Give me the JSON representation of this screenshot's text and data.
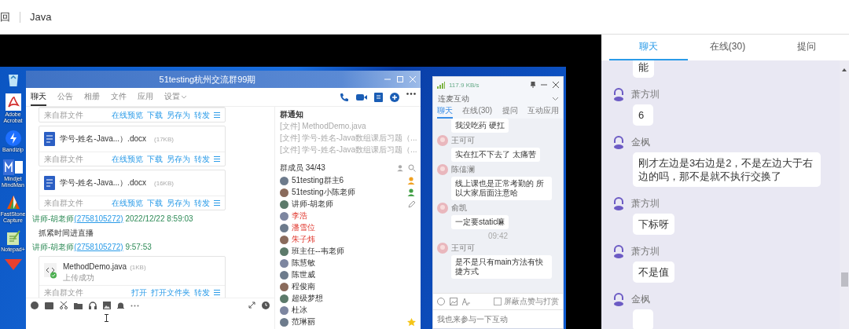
{
  "top_bar": {
    "back": "回",
    "title": "Java"
  },
  "desktop_icons": [
    {
      "kind": "recycle"
    },
    {
      "kind": "pdf",
      "label": "Adobe Acrobat"
    },
    {
      "kind": "zip",
      "label": "Bandizip"
    },
    {
      "kind": "mindmap",
      "label": "Mindjet MindMan"
    },
    {
      "kind": "capture",
      "label": "FastStone Capture"
    },
    {
      "kind": "notepad",
      "label": "Notepad+"
    },
    {
      "kind": "office"
    }
  ],
  "qq_window": {
    "title": "51testing杭州交流群99期",
    "tabs": [
      {
        "label": "聊天",
        "selected": true
      },
      {
        "label": "公告",
        "selected": false
      },
      {
        "label": "相册",
        "selected": false
      },
      {
        "label": "文件",
        "selected": false
      },
      {
        "label": "应用",
        "selected": false
      },
      {
        "label": "设置",
        "selected": false
      }
    ],
    "messages": [
      {
        "kind": "file_footer",
        "source": "来自群文件",
        "actions": [
          "在线预览",
          "下载",
          "另存为",
          "转发"
        ]
      },
      {
        "kind": "file",
        "name": "学号-姓名-Java...）.docx",
        "size": "(17KB)",
        "source": "来自群文件",
        "actions": [
          "在线预览",
          "下载",
          "另存为",
          "转发"
        ]
      },
      {
        "kind": "file",
        "name": "学号-姓名-Java...）.docx",
        "size": "(16KB)",
        "source": "来自群文件",
        "actions": [
          "在线预览",
          "下载",
          "另存为",
          "转发"
        ]
      },
      {
        "kind": "header",
        "sender": "讲师-胡老师",
        "qq": "(2758105272)",
        "time": "2022/12/22 8:59:03"
      },
      {
        "kind": "text",
        "text": "抓紧时间进直播"
      },
      {
        "kind": "header",
        "sender": "讲师-胡老师",
        "qq": "(2758105272)",
        "time": "9:57:53"
      },
      {
        "kind": "upload",
        "name": "MethodDemo.java",
        "size": "(1KB)",
        "status": "上传成功",
        "source": "来自群文件",
        "actions": [
          "打开",
          "打开文件夹",
          "转发"
        ]
      }
    ],
    "notice": {
      "title": "群通知",
      "items": [
        "[文件] MethodDemo.java",
        "[文件] 学号-姓名-Java数组课后习题（...",
        "[文件] 学号-姓名-Java数组课后习题（..."
      ]
    },
    "members_title": "群成员 34/43",
    "members": [
      {
        "name": "51testing群主6",
        "highlighted": false,
        "kind": "owner"
      },
      {
        "name": "51testing小陈老师",
        "highlighted": false,
        "kind": "admin"
      },
      {
        "name": "讲师-胡老师",
        "highlighted": false,
        "kind": "pencil"
      },
      {
        "name": "李浩",
        "highlighted": true,
        "kind": "plain"
      },
      {
        "name": "潘雪位",
        "highlighted": true,
        "kind": "plain"
      },
      {
        "name": "朱子炜",
        "highlighted": true,
        "kind": "plain"
      },
      {
        "name": "班主任--韦老师",
        "highlighted": false,
        "kind": "plain"
      },
      {
        "name": "陈慧敏",
        "highlighted": false,
        "kind": "plain"
      },
      {
        "name": "陈世威",
        "highlighted": false,
        "kind": "plain"
      },
      {
        "name": "程俊南",
        "highlighted": false,
        "kind": "plain"
      },
      {
        "name": "超级梦想",
        "highlighted": false,
        "kind": "plain"
      },
      {
        "name": "杜冰",
        "highlighted": false,
        "kind": "plain"
      },
      {
        "name": "范琳丽",
        "highlighted": false,
        "kind": "star"
      }
    ]
  },
  "live_window": {
    "speed": "117.9 KB/s",
    "mode": "连麦互动",
    "tabs": [
      {
        "label": "聊天",
        "selected": true
      },
      {
        "label": "在线(30)",
        "selected": false
      },
      {
        "label": "提问",
        "selected": false
      },
      {
        "label": "互动应用",
        "selected": false
      }
    ],
    "messages": [
      {
        "kind": "bubble",
        "text": "我没吃药 硬扛"
      },
      {
        "kind": "bubble",
        "name": "王可可",
        "text": "实在扛不下去了 太痛苦"
      },
      {
        "kind": "bubble",
        "name": "陈僖澜",
        "text": "线上课也是正常考勤的 所以大家后面注意哈"
      },
      {
        "kind": "bubble",
        "name": "俞凯",
        "text": "一定要static嘛"
      },
      {
        "kind": "time",
        "text": "09:42"
      },
      {
        "kind": "bubble",
        "name": "王可可",
        "text": "是不是只有main方法有快捷方式"
      }
    ],
    "block_label": "屏蔽点赞与打赏",
    "block_checked": false,
    "placeholder": "我也来参与一下互动"
  },
  "side_panel": {
    "tabs": [
      {
        "label": "聊天",
        "selected": true
      },
      {
        "label": "在线(30)",
        "selected": false
      },
      {
        "label": "提问",
        "selected": false
      }
    ],
    "messages": [
      {
        "text": "能"
      },
      {
        "name": "萧方圳",
        "text": "6"
      },
      {
        "name": "金枫",
        "text": "刚才左边是3右边是2，不是左边大于右边的吗，那不是就不执行交换了"
      },
      {
        "name": "萧方圳",
        "text": "下标呀"
      },
      {
        "name": "萧方圳",
        "text": "不是值"
      },
      {
        "name": "金枫"
      }
    ]
  }
}
